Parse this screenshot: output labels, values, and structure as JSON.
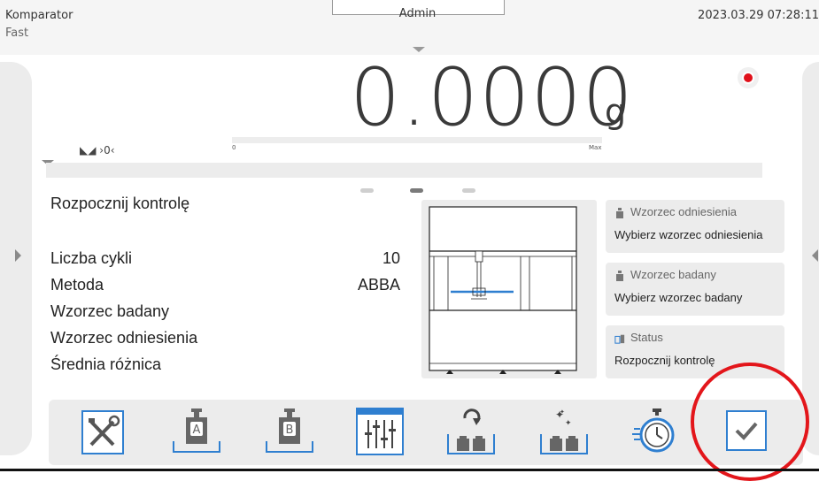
{
  "header": {
    "app_title": "Komparator",
    "mode": "Fast",
    "user": "Admin",
    "datetime": "2023.03.29 07:28:11"
  },
  "display": {
    "weight": "0.0000",
    "unit": "g",
    "status_symbols": "◣◢ ›0‹",
    "bar_min": "0",
    "bar_max": "Max",
    "record_color": "#e0101a"
  },
  "pager": {
    "pages": 3,
    "active": 2
  },
  "main": {
    "start_label": "Rozpocznij kontrolę",
    "rows": [
      {
        "label": "Liczba cykli",
        "value": "10"
      },
      {
        "label": "Metoda",
        "value": "ABBA"
      },
      {
        "label": "Wzorzec badany",
        "value": ""
      },
      {
        "label": "Wzorzec odniesienia",
        "value": ""
      },
      {
        "label": "Średnia różnica",
        "value": ""
      }
    ]
  },
  "cards": [
    {
      "title": "Wzorzec odniesienia",
      "value": "Wybierz wzorzec odniesienia",
      "icon": "weight-icon"
    },
    {
      "title": "Wzorzec badany",
      "value": "Wybierz wzorzec badany",
      "icon": "weight-icon"
    },
    {
      "title": "Status",
      "value": "Rozpocznij kontrolę",
      "icon": "status-icon"
    }
  ],
  "toolbar": {
    "buttons": [
      {
        "name": "settings-tools-button",
        "icon": "tools-icon",
        "letter": ""
      },
      {
        "name": "weight-a-button",
        "icon": "weight-a-icon",
        "letter": "A"
      },
      {
        "name": "weight-b-button",
        "icon": "weight-b-icon",
        "letter": "B"
      },
      {
        "name": "parameters-button",
        "icon": "sliders-icon",
        "letter": ""
      },
      {
        "name": "swap-weights-button",
        "icon": "swap-weights-icon",
        "letter": ""
      },
      {
        "name": "clean-weights-button",
        "icon": "sparkle-weights-icon",
        "letter": ""
      },
      {
        "name": "timer-button",
        "icon": "stopwatch-icon",
        "letter": ""
      },
      {
        "name": "confirm-button",
        "icon": "check-icon",
        "letter": ""
      }
    ],
    "icon_color": "#2f7fd0"
  },
  "accent": {
    "highlight": "#e3161b",
    "blue": "#2f7fd0"
  }
}
